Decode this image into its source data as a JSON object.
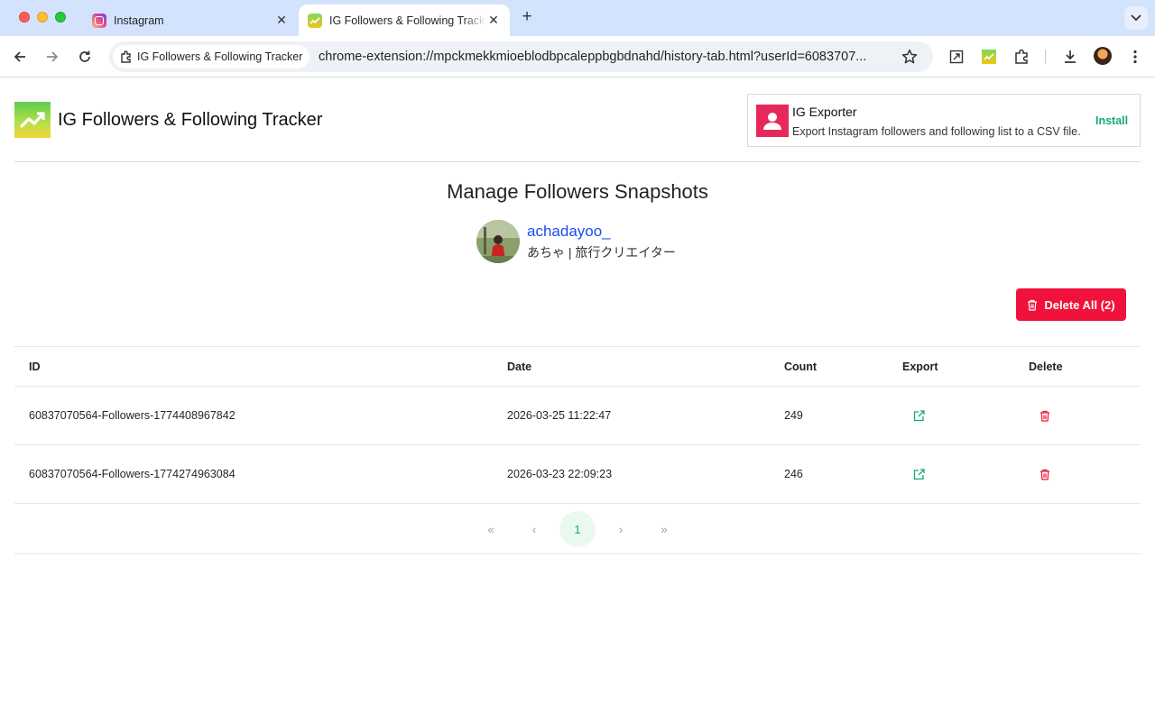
{
  "browser": {
    "tabs": [
      {
        "title": "Instagram",
        "active": false,
        "favicon": "instagram-icon"
      },
      {
        "title": "IG Followers & Following Tracker",
        "active": true,
        "favicon": "tracker-icon"
      }
    ],
    "omnibox": {
      "chip_label": "IG Followers & Following Tracker",
      "url": "chrome-extension://mpckmekkmioeblodbpcaleppbgbdnahd/history-tab.html?userId=6083707..."
    }
  },
  "header": {
    "app_name": "IG Followers & Following Tracker"
  },
  "promo": {
    "title": "IG Exporter",
    "description": "Export Instagram followers and following list to a CSV file.",
    "install_label": "Install"
  },
  "main": {
    "title": "Manage Followers Snapshots",
    "profile": {
      "username": "achadayoo_",
      "full_name": "あちゃ | 旅行クリエイター"
    },
    "delete_all_label": "Delete All (2)",
    "table": {
      "columns": [
        "ID",
        "Date",
        "Count",
        "Export",
        "Delete"
      ],
      "rows": [
        {
          "id": "60837070564-Followers-1774408967842",
          "date": "2026-03-25 11:22:47",
          "count": "249"
        },
        {
          "id": "60837070564-Followers-1774274963084",
          "date": "2026-03-23 22:09:23",
          "count": "246"
        }
      ]
    },
    "pagination": {
      "current_page": "1",
      "first": "«",
      "prev": "‹",
      "next": "›",
      "last": "»"
    }
  },
  "colors": {
    "accent_green": "#19a974",
    "danger_red": "#f0123a",
    "link_blue": "#1a4cf0"
  }
}
